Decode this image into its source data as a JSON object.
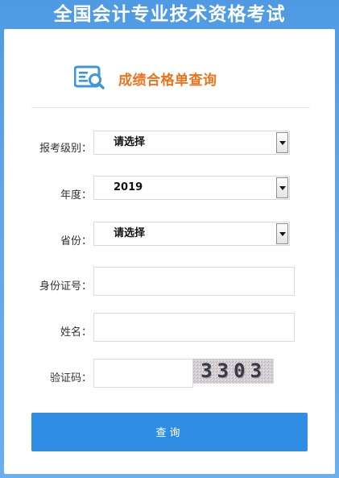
{
  "page": {
    "title": "全国会计专业技术资格考试"
  },
  "heading": {
    "icon": "search-document-icon",
    "text": "成绩合格单查询",
    "color": "#f2721c"
  },
  "form": {
    "level": {
      "label": "报考级别：",
      "value": "请选择"
    },
    "year": {
      "label": "年度：",
      "value": "2019"
    },
    "province": {
      "label": "省份：",
      "value": "请选择"
    },
    "id_number": {
      "label": "身份证号：",
      "value": "",
      "placeholder": ""
    },
    "name": {
      "label": "姓名：",
      "value": "",
      "placeholder": ""
    },
    "captcha": {
      "label": "验证码：",
      "value": "",
      "placeholder": "",
      "image_text": "3303"
    }
  },
  "query_button": {
    "label": "查询",
    "color": "#2f8ee3"
  },
  "colors": {
    "background": "#5ea6ea",
    "card": "#ffffff"
  }
}
